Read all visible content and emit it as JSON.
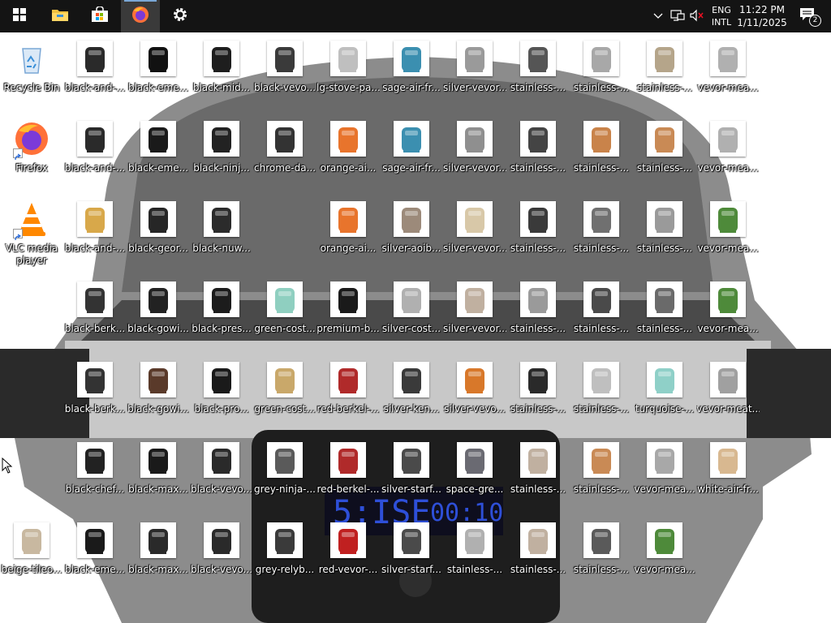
{
  "taskbar": {
    "start_icon": "windows-logo-icon",
    "pinned": [
      {
        "name": "file-explorer",
        "icon": "folder-icon"
      },
      {
        "name": "microsoft-store",
        "icon": "store-bag-icon"
      },
      {
        "name": "firefox",
        "icon": "firefox-icon",
        "active": true
      },
      {
        "name": "settings",
        "icon": "gear-icon"
      }
    ],
    "tray": {
      "language_top": "ENG",
      "language_bottom": "INTL",
      "time": "11:22 PM",
      "date": "1/11/2025",
      "notification_count": "2"
    }
  },
  "desktop": {
    "icons": [
      {
        "label": "Recycle Bin",
        "type": "recycle",
        "color": "#7aa7d6"
      },
      {
        "label": "black-and-...",
        "type": "product",
        "color": "#2a2a2a"
      },
      {
        "label": "black-eme...",
        "type": "product",
        "color": "#111111"
      },
      {
        "label": "black-mid...",
        "type": "product",
        "color": "#1e1e1e"
      },
      {
        "label": "black-vevo...",
        "type": "product",
        "color": "#3a3a3a"
      },
      {
        "label": "lg-stove-pa...",
        "type": "product",
        "color": "#bfbfbf"
      },
      {
        "label": "sage-air-fr...",
        "type": "product",
        "color": "#3b8fb0"
      },
      {
        "label": "silver-vevor...",
        "type": "product",
        "color": "#9a9a9a"
      },
      {
        "label": "stainless-...",
        "type": "product",
        "color": "#555555"
      },
      {
        "label": "stainless-...",
        "type": "product",
        "color": "#a8a8a8"
      },
      {
        "label": "stainless-...",
        "type": "product",
        "color": "#b5a58a"
      },
      {
        "label": "vevor-mea...",
        "type": "product",
        "color": "#b0b0b0"
      },
      {
        "label": "Firefox",
        "type": "firefox",
        "color": "#ff7139"
      },
      {
        "label": "black-and-...",
        "type": "product",
        "color": "#2a2a2a"
      },
      {
        "label": "black-eme...",
        "type": "product",
        "color": "#1a1a1a"
      },
      {
        "label": "black-ninj...",
        "type": "product",
        "color": "#222222"
      },
      {
        "label": "chrome-da...",
        "type": "product",
        "color": "#333333"
      },
      {
        "label": "orange-ai...",
        "type": "product",
        "color": "#e8742c"
      },
      {
        "label": "sage-air-fr...",
        "type": "product",
        "color": "#3b8fb0"
      },
      {
        "label": "silver-vevor...",
        "type": "product",
        "color": "#8f8f8f"
      },
      {
        "label": "stainless-...",
        "type": "product",
        "color": "#444444"
      },
      {
        "label": "stainless-...",
        "type": "product",
        "color": "#c9834a"
      },
      {
        "label": "stainless-...",
        "type": "product",
        "color": "#c98a55"
      },
      {
        "label": "vevor-mea...",
        "type": "product",
        "color": "#b0b0b0"
      },
      {
        "label": "VLC media player",
        "type": "vlc",
        "color": "#ff8800"
      },
      {
        "label": "black-and-...",
        "type": "product",
        "color": "#d8a84a"
      },
      {
        "label": "black-geor...",
        "type": "product",
        "color": "#262626"
      },
      {
        "label": "black-nuw...",
        "type": "product",
        "color": "#2b2b2b"
      },
      {
        "label": "orange-ai...",
        "type": "product",
        "color": "#e8742c"
      },
      {
        "label": "silver-aoib...",
        "type": "product",
        "color": "#9c8a7a"
      },
      {
        "label": "silver-vevor...",
        "type": "product",
        "color": "#d8c8a8"
      },
      {
        "label": "stainless-...",
        "type": "product",
        "color": "#3a3a3a"
      },
      {
        "label": "stainless-...",
        "type": "product",
        "color": "#707070"
      },
      {
        "label": "stainless-...",
        "type": "product",
        "color": "#9a9a9a"
      },
      {
        "label": "vevor-mea...",
        "type": "product",
        "color": "#4e8a3a"
      },
      {
        "label": "black-berk...",
        "type": "product",
        "color": "#333333"
      },
      {
        "label": "black-gowi...",
        "type": "product",
        "color": "#222222"
      },
      {
        "label": "black-pres...",
        "type": "product",
        "color": "#1c1c1c"
      },
      {
        "label": "green-cost...",
        "type": "product",
        "color": "#8fcfc0"
      },
      {
        "label": "premium-b...",
        "type": "product",
        "color": "#1a1a1a"
      },
      {
        "label": "silver-cost...",
        "type": "product",
        "color": "#b0b0b0"
      },
      {
        "label": "silver-vevor...",
        "type": "product",
        "color": "#c0b0a0"
      },
      {
        "label": "stainless-...",
        "type": "product",
        "color": "#9a9a9a"
      },
      {
        "label": "stainless-...",
        "type": "product",
        "color": "#4a4a4a"
      },
      {
        "label": "stainless-...",
        "type": "product",
        "color": "#6a6a6a"
      },
      {
        "label": "vevor-mea...",
        "type": "product",
        "color": "#4e8a3a"
      },
      {
        "label": "black-berk...",
        "type": "product",
        "color": "#333333"
      },
      {
        "label": "black-gowi...",
        "type": "product",
        "color": "#5a3a2a"
      },
      {
        "label": "black-pro...",
        "type": "product",
        "color": "#1a1a1a"
      },
      {
        "label": "green-cost...",
        "type": "product",
        "color": "#c9a86a"
      },
      {
        "label": "red-berkel-...",
        "type": "product",
        "color": "#b02a2a"
      },
      {
        "label": "silver-ken...",
        "type": "product",
        "color": "#3a3a3a"
      },
      {
        "label": "silver-vevo...",
        "type": "product",
        "color": "#d8782a"
      },
      {
        "label": "stainless-...",
        "type": "product",
        "color": "#2a2a2a"
      },
      {
        "label": "stainless-...",
        "type": "product",
        "color": "#bfbfbf"
      },
      {
        "label": "turquoise-...",
        "type": "product",
        "color": "#8fd0c8"
      },
      {
        "label": "vevor-meat...",
        "type": "product",
        "color": "#a0a0a0"
      },
      {
        "label": "black-chef...",
        "type": "product",
        "color": "#222222"
      },
      {
        "label": "black-max...",
        "type": "product",
        "color": "#1a1a1a"
      },
      {
        "label": "black-vevo...",
        "type": "product",
        "color": "#2a2a2a"
      },
      {
        "label": "grey-ninja-...",
        "type": "product",
        "color": "#5a5a5a"
      },
      {
        "label": "red-berkel-...",
        "type": "product",
        "color": "#b02a2a"
      },
      {
        "label": "silver-starf...",
        "type": "product",
        "color": "#4a4a4a"
      },
      {
        "label": "space-gre...",
        "type": "product",
        "color": "#6a6a72"
      },
      {
        "label": "stainless-...",
        "type": "product",
        "color": "#c0b0a0"
      },
      {
        "label": "stainless-...",
        "type": "product",
        "color": "#c98a55"
      },
      {
        "label": "vevor-mea...",
        "type": "product",
        "color": "#a8a8a8"
      },
      {
        "label": "white-air-fr...",
        "type": "product",
        "color": "#d8b890"
      },
      {
        "label": "beige-tileo...",
        "type": "product",
        "color": "#c8b8a0"
      },
      {
        "label": "black-eme...",
        "type": "product",
        "color": "#1a1a1a"
      },
      {
        "label": "black-max...",
        "type": "product",
        "color": "#2a2a2a"
      },
      {
        "label": "black-vevo...",
        "type": "product",
        "color": "#2a2a2a"
      },
      {
        "label": "grey-relyb...",
        "type": "product",
        "color": "#3a3a3a"
      },
      {
        "label": "red-vevor-...",
        "type": "product",
        "color": "#c02020"
      },
      {
        "label": "silver-starf...",
        "type": "product",
        "color": "#4a4a4a"
      },
      {
        "label": "stainless-...",
        "type": "product",
        "color": "#b0b0b0"
      },
      {
        "label": "stainless-...",
        "type": "product",
        "color": "#c0b0a0"
      },
      {
        "label": "stainless-...",
        "type": "product",
        "color": "#5a5a5a"
      },
      {
        "label": "vevor-mea...",
        "type": "product",
        "color": "#4e8a3a"
      }
    ]
  }
}
